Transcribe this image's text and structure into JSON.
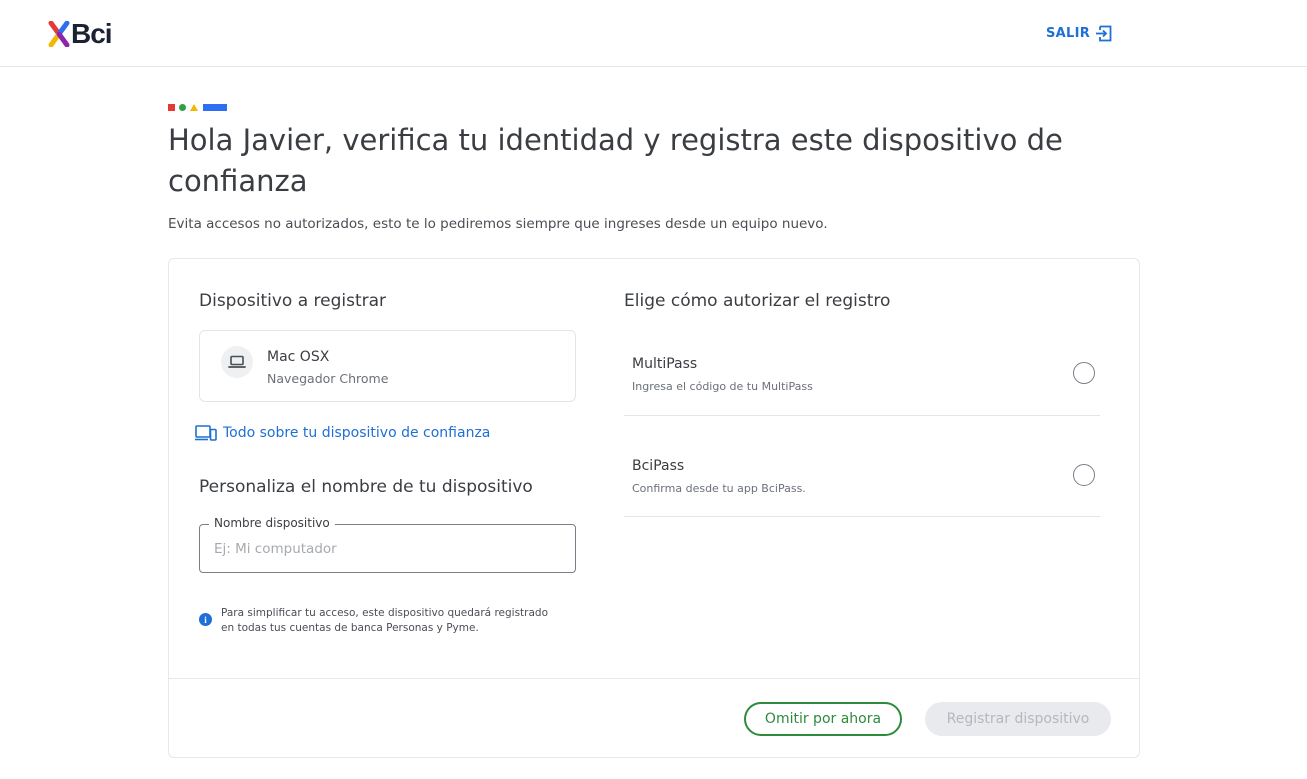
{
  "header": {
    "logo_text": "Bci",
    "logo_icon": "bci-x-logo-icon",
    "logout_label": "SALIR",
    "logout_icon": "exit-icon"
  },
  "page": {
    "title": "Hola Javier, verifica tu identidad y registra este dispositivo de confianza",
    "subtitle": "Evita accesos no autorizados, esto te lo pediremos siempre que ingreses desde un equipo nuevo."
  },
  "device_section": {
    "title": "Dispositivo a registrar",
    "device_icon": "laptop-icon",
    "device_name": "Mac OSX",
    "device_browser": "Navegador Chrome",
    "info_link_icon": "devices-icon",
    "info_link": "Todo sobre tu dispositivo de confianza"
  },
  "customize": {
    "title": "Personaliza el nombre de tu dispositivo",
    "field_label": "Nombre dispositivo",
    "field_value": "",
    "field_placeholder": "Ej: Mi computador",
    "note_icon": "info-icon",
    "note": "Para simplificar tu acceso, este dispositivo quedará registrado en todas tus cuentas de banca Personas y Pyme."
  },
  "authorize": {
    "title": "Elige cómo autorizar el registro",
    "options": [
      {
        "title": "MultiPass",
        "subtitle": "Ingresa el código de tu MultiPass",
        "selected": false
      },
      {
        "title": "BciPass",
        "subtitle": "Confirma desde tu app BciPass.",
        "selected": false
      }
    ]
  },
  "actions": {
    "skip_label": "Omitir por ahora",
    "register_label": "Registrar dispositivo",
    "register_enabled": false
  },
  "colors": {
    "link_blue": "#1f6fd4",
    "green": "#2e8b3c",
    "accent_red": "#e53935",
    "accent_green": "#2e9f44",
    "accent_yellow": "#f2b705",
    "accent_blue": "#2d6ff2"
  }
}
